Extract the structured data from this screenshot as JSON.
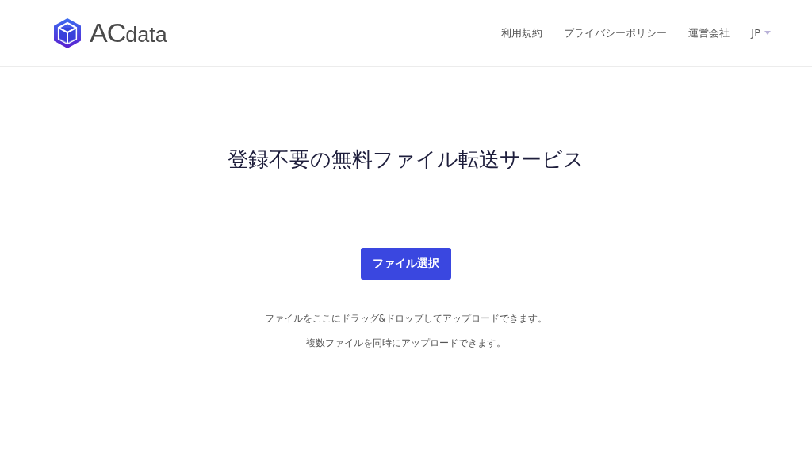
{
  "header": {
    "logo": {
      "large": "AC",
      "small": "data"
    },
    "nav": [
      {
        "label": "利用規約"
      },
      {
        "label": "プライバシーポリシー"
      },
      {
        "label": "運営会社"
      }
    ],
    "language": {
      "label": "JP"
    }
  },
  "main": {
    "title": "登録不要の無料ファイル転送サービス",
    "button": "ファイル選択",
    "notes": [
      "ファイルをここにドラッグ&ドロップしてアップロードできます。",
      "複数ファイルを同時にアップロードできます。"
    ]
  }
}
